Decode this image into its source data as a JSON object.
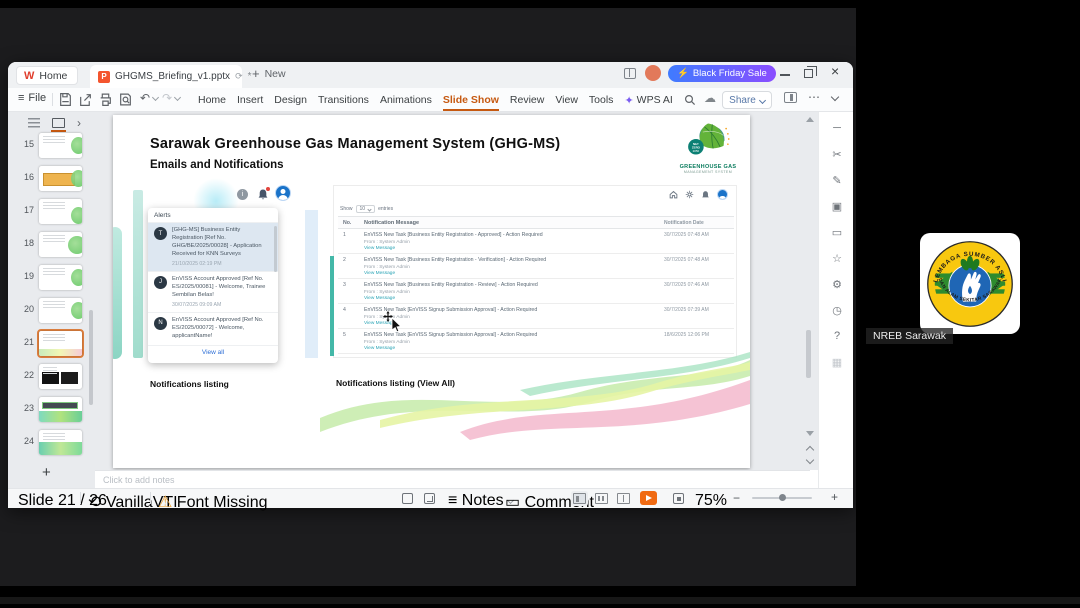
{
  "titlebar": {
    "home_label": "Home",
    "doc_tab": "GHGMS_Briefing_v1.pptx",
    "modified_mark": "*",
    "new_label": "New",
    "promo_label": "Black Friday Sale"
  },
  "ribbon": {
    "file_label": "File",
    "menus": [
      "Home",
      "Insert",
      "Design",
      "Transitions",
      "Animations",
      "Slide Show",
      "Review",
      "View",
      "Tools"
    ],
    "active_menu": "Slide Show",
    "wps_ai_label": "WPS AI",
    "share_label": "Share"
  },
  "thumbnails": {
    "numbers": [
      "15",
      "16",
      "17",
      "18",
      "19",
      "20",
      "21",
      "22",
      "23",
      "24"
    ]
  },
  "slide": {
    "title": "Sarawak Greenhouse Gas Management System (GHG-MS)",
    "subtitle": "Emails and Notifications",
    "logo": {
      "badge_line1": "NET",
      "badge_line2": "ZERO",
      "badge_line3": "2050",
      "name_line1": "GREENHOUSE GAS",
      "name_line2": "MANAGEMENT SYSTEM"
    },
    "alerts": {
      "header": "Alerts",
      "view_all": "View all",
      "items": [
        {
          "initial": "T",
          "text": "[GHG-MS] Business Entity Registration [Ref No. GHG/BE/2025/00028] - Application Received for KNN Surveys",
          "time": "21/10/2025 02:19 PM"
        },
        {
          "initial": "J",
          "text": "EnVISS Account Approved [Ref No. ES/2025/00081] - Welcome, Trainee Sembilan Belas!",
          "time": "30/07/2025 09:09 AM"
        },
        {
          "initial": "N",
          "text": "EnVISS Account Approved [Ref No. ES/2025/00072] - Welcome, applicantName!",
          "time": ""
        }
      ]
    },
    "table": {
      "show_label": "Show",
      "page_size": "10",
      "entries_label": "entries",
      "columns": {
        "no": "No.",
        "message": "Notification Message",
        "date": "Notification Date"
      },
      "rows": [
        {
          "no": "1",
          "message": "EnVISS New Task [Business Entity Registration - Approved] - Action Required",
          "from": "From : System Admin",
          "link": "View Message",
          "date": "30/7/2025 07:48 AM"
        },
        {
          "no": "2",
          "message": "EnVISS New Task [Business Entity Registration - Verification] - Action Required",
          "from": "From : System Admin",
          "link": "View Message",
          "date": "30/7/2025 07:48 AM"
        },
        {
          "no": "3",
          "message": "EnVISS New Task [Business Entity Registration - Review] - Action Required",
          "from": "From : System Admin",
          "link": "View Message",
          "date": "30/7/2025 07:46 AM"
        },
        {
          "no": "4",
          "message": "EnVISS New Task [EnVISS Signup Submission Approval] - Action Required",
          "from": "From : System Admin",
          "link": "View Message",
          "date": "30/7/2025 07:39 AM"
        },
        {
          "no": "5",
          "message": "EnVISS New Task [EnVISS Signup Submission Approval] - Action Required",
          "from": "From : System Admin",
          "link": "View Message",
          "date": "18/6/2025 12:06 PM"
        }
      ]
    },
    "caption_left": "Notifications listing",
    "caption_right": "Notifications listing (View All)"
  },
  "notes": {
    "placeholder": "Click to add notes"
  },
  "statusbar": {
    "slide_indicator": "Slide 21 / 26",
    "language": "VanillaVTI",
    "font_warning": "Font Missing",
    "notes_label": "Notes",
    "comment_label": "Comment",
    "zoom_level": "75%"
  },
  "meeting": {
    "participant_name": "NREB Sarawak",
    "logo_top_text": "LEMBAGA SUMBER ASLI",
    "logo_bottom_text": "DAN ALAM SEKITAR SARAWAK"
  },
  "icons": {
    "file_menu": "≡",
    "cloud": "☁",
    "more": "⋯",
    "wps_ai_sparkle": "✦",
    "lightning": "⚡",
    "undo": "↶",
    "redo": "↷",
    "font_warning": "⚠",
    "language_sync": "⟲",
    "doc_sync": "⟳",
    "notes_lines": "≡",
    "chevron_right": "›",
    "plus": "+",
    "close": "×",
    "sidebar_hide": "─",
    "cut": "✂",
    "pen": "✎",
    "shape": "▣",
    "comment_box": "▭",
    "star": "☆",
    "gear": "⚙",
    "history": "◷",
    "help": "?",
    "apps": "▦",
    "info": "i"
  },
  "colors": {
    "accent_orange": "#c65911",
    "promo_start": "#3f7bff",
    "promo_end": "#8a4dff",
    "play_button": "#f06a12",
    "link_teal": "#2aa4b6",
    "selection_blue": "#dde7f1"
  }
}
